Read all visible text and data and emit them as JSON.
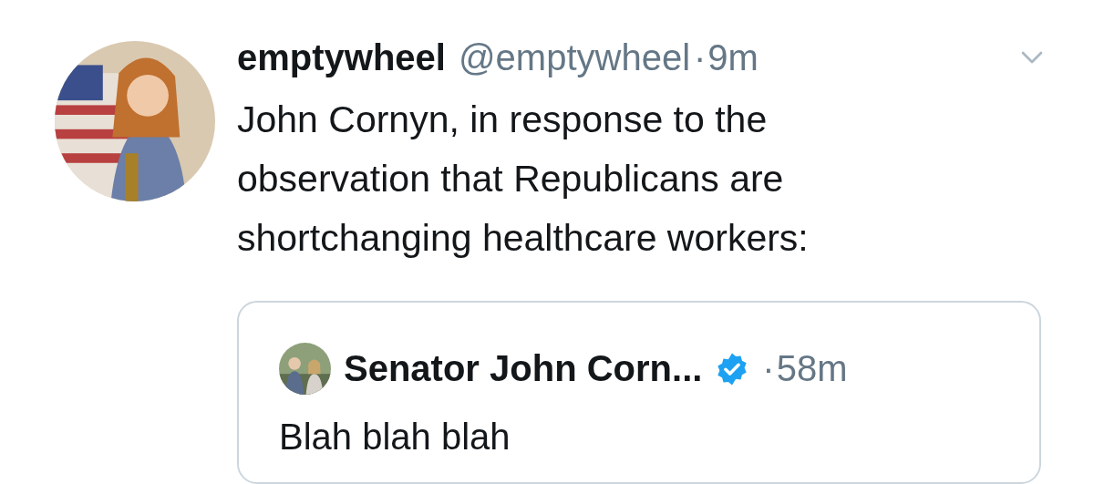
{
  "tweet": {
    "author": {
      "name": "emptywheel",
      "handle": "@emptywheel",
      "separator": "·",
      "time": "9m"
    },
    "text_lines": [
      "John Cornyn, in response to the",
      "observation that Republicans are",
      "shortchanging healthcare workers:"
    ],
    "quoted": {
      "author": {
        "name": "Senator John Corn...",
        "verified": true,
        "separator": "·",
        "time": "58m"
      },
      "text": "Blah blah blah"
    }
  }
}
